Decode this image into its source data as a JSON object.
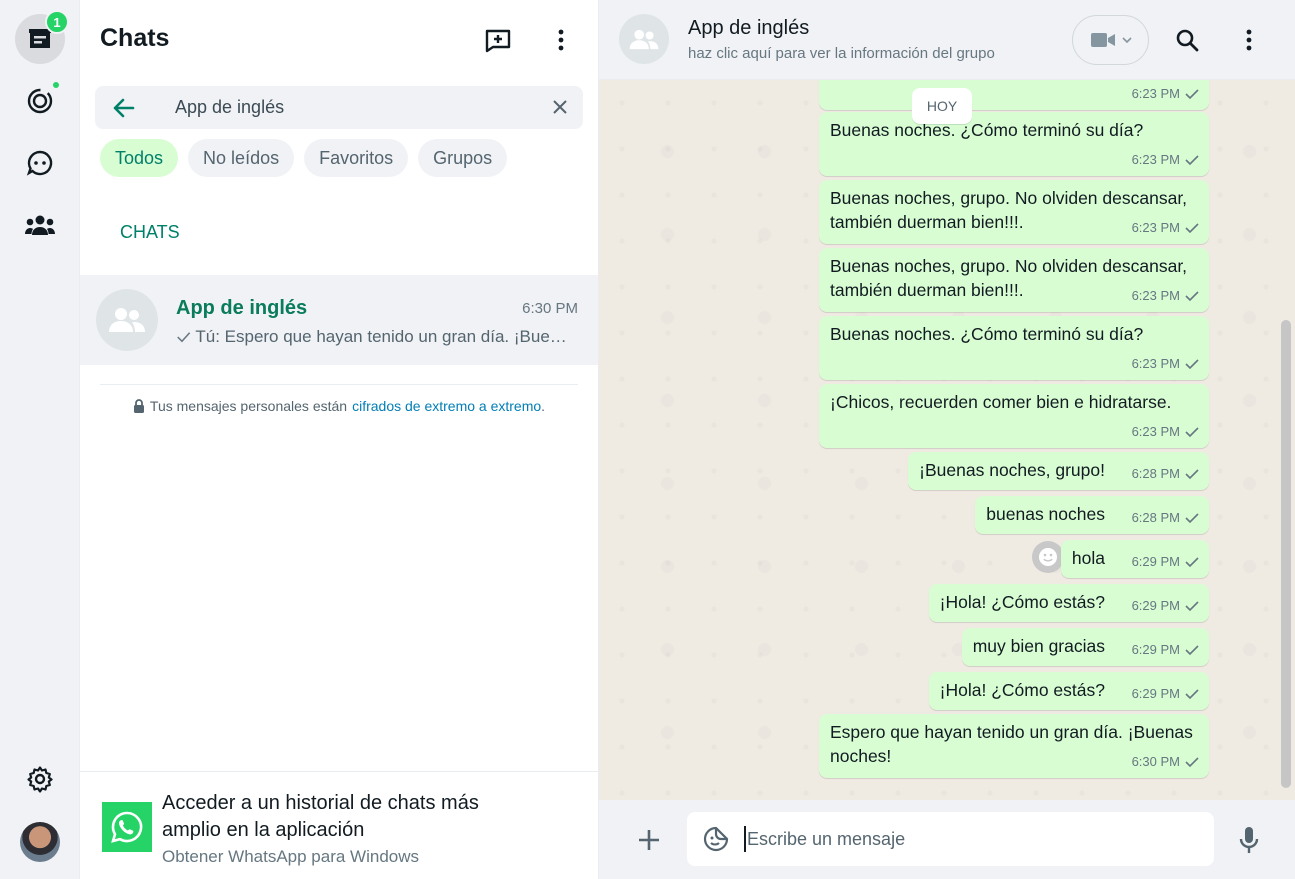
{
  "rail": {
    "chats_badge": "1",
    "items": [
      "chats-icon",
      "status-icon",
      "channels-icon",
      "communities-icon",
      "settings-icon"
    ]
  },
  "list": {
    "title": "Chats",
    "search_value": "App de inglés",
    "filters": [
      "Todos",
      "No leídos",
      "Favoritos",
      "Grupos"
    ],
    "active_filter": "Todos",
    "section_label": "CHATS",
    "chat": {
      "name": "App de inglés",
      "time": "6:30 PM",
      "preview": "Tú: Espero que hayan tenido un gran día. ¡Buenas noches!"
    },
    "encryption_text": "Tus mensajes personales están",
    "encryption_link": "cifrados de extremo a extremo",
    "encryption_end": ".",
    "promo": {
      "title": "Acceder a un historial de chats más amplio en la aplicación",
      "subtitle": "Obtener WhatsApp para Windows"
    }
  },
  "conversation": {
    "name": "App de inglés",
    "subtitle": "haz clic aquí para ver la información del grupo",
    "day_label": "HOY",
    "messages": [
      {
        "text": "",
        "time": "6:23 PM"
      },
      {
        "text": "Buenas noches. ¿Cómo terminó su día?",
        "time": "6:23 PM"
      },
      {
        "text": "Buenas noches, grupo. No olviden descansar, también duerman bien!!!.",
        "time": "6:23 PM"
      },
      {
        "text": "Buenas noches, grupo. No olviden descansar, también duerman bien!!!.",
        "time": "6:23 PM"
      },
      {
        "text": "Buenas noches. ¿Cómo terminó su día?",
        "time": "6:23 PM"
      },
      {
        "text": "¡Chicos, recuerden comer bien e hidratarse.",
        "time": "6:23 PM"
      },
      {
        "text": "¡Buenas noches, grupo!",
        "time": "6:28 PM"
      },
      {
        "text": "buenas noches",
        "time": "6:28 PM"
      },
      {
        "text": "hola",
        "time": "6:29 PM"
      },
      {
        "text": "¡Hola! ¿Cómo estás?",
        "time": "6:29 PM"
      },
      {
        "text": "muy bien gracias",
        "time": "6:29 PM"
      },
      {
        "text": "¡Hola! ¿Cómo estás?",
        "time": "6:29 PM"
      },
      {
        "text": "Espero que hayan tenido un gran día. ¡Buenas noches!",
        "time": "6:30 PM"
      }
    ],
    "composer_placeholder": "Escribe un mensaje"
  },
  "colors": {
    "accent": "#008069",
    "bubble_out": "#d9fdd3",
    "badge": "#25d366",
    "wallpaper": "#efeae2"
  }
}
